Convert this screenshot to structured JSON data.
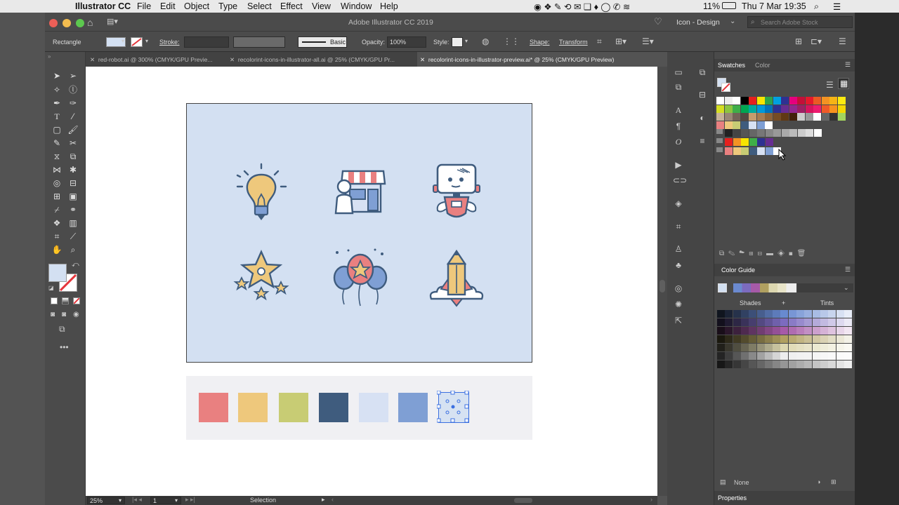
{
  "menubar": {
    "app": "Illustrator CC",
    "items": [
      "File",
      "Edit",
      "Object",
      "Type",
      "Select",
      "Effect",
      "View",
      "Window",
      "Help"
    ],
    "battery": "11%",
    "datetime": "Thu 7 Mar  19:35"
  },
  "titlebar": {
    "title": "Adobe Illustrator CC 2019",
    "workspace": "Icon - Design",
    "search_placeholder": "Search Adobe Stock"
  },
  "control": {
    "selection_type": "Rectangle",
    "stroke_label": "Stroke:",
    "brush_label": "Basic",
    "opacity_label": "Opacity:",
    "opacity_value": "100%",
    "style_label": "Style:",
    "shape_label": "Shape:",
    "transform_label": "Transform"
  },
  "tabs": [
    {
      "label": "red-robot.ai @ 300% (CMYK/GPU Previe..."
    },
    {
      "label": "recolorint-icons-in-illustrator-all.ai @ 25% (CMYK/GPU Pr..."
    },
    {
      "label": "recolorint-icons-in-illustrator-preview.ai* @ 25% (CMYK/GPU Preview)"
    }
  ],
  "palette": {
    "colors": [
      "#e98080",
      "#eec87c",
      "#c8cc74",
      "#3f5c7e",
      "#d7e1f3",
      "#7f9fd4"
    ],
    "selected_color": "#d3e0f2"
  },
  "icons": [
    "lightbulb-icon",
    "shop-icon",
    "robot-icon",
    "stars-icon",
    "balloons-icon",
    "rocket-pencil-icon"
  ],
  "statusbar": {
    "zoom": "25%",
    "artboard": "1",
    "tool": "Selection"
  },
  "panels": {
    "swatches_tab": "Swatches",
    "color_tab": "Color",
    "color_guide_title": "Color Guide",
    "shades_label": "Shades",
    "tints_label": "Tints",
    "none_label": "None",
    "properties_label": "Properties"
  },
  "colors": {
    "accent_red": "#e5353b",
    "artboard_bg": "#d3e0f2"
  }
}
